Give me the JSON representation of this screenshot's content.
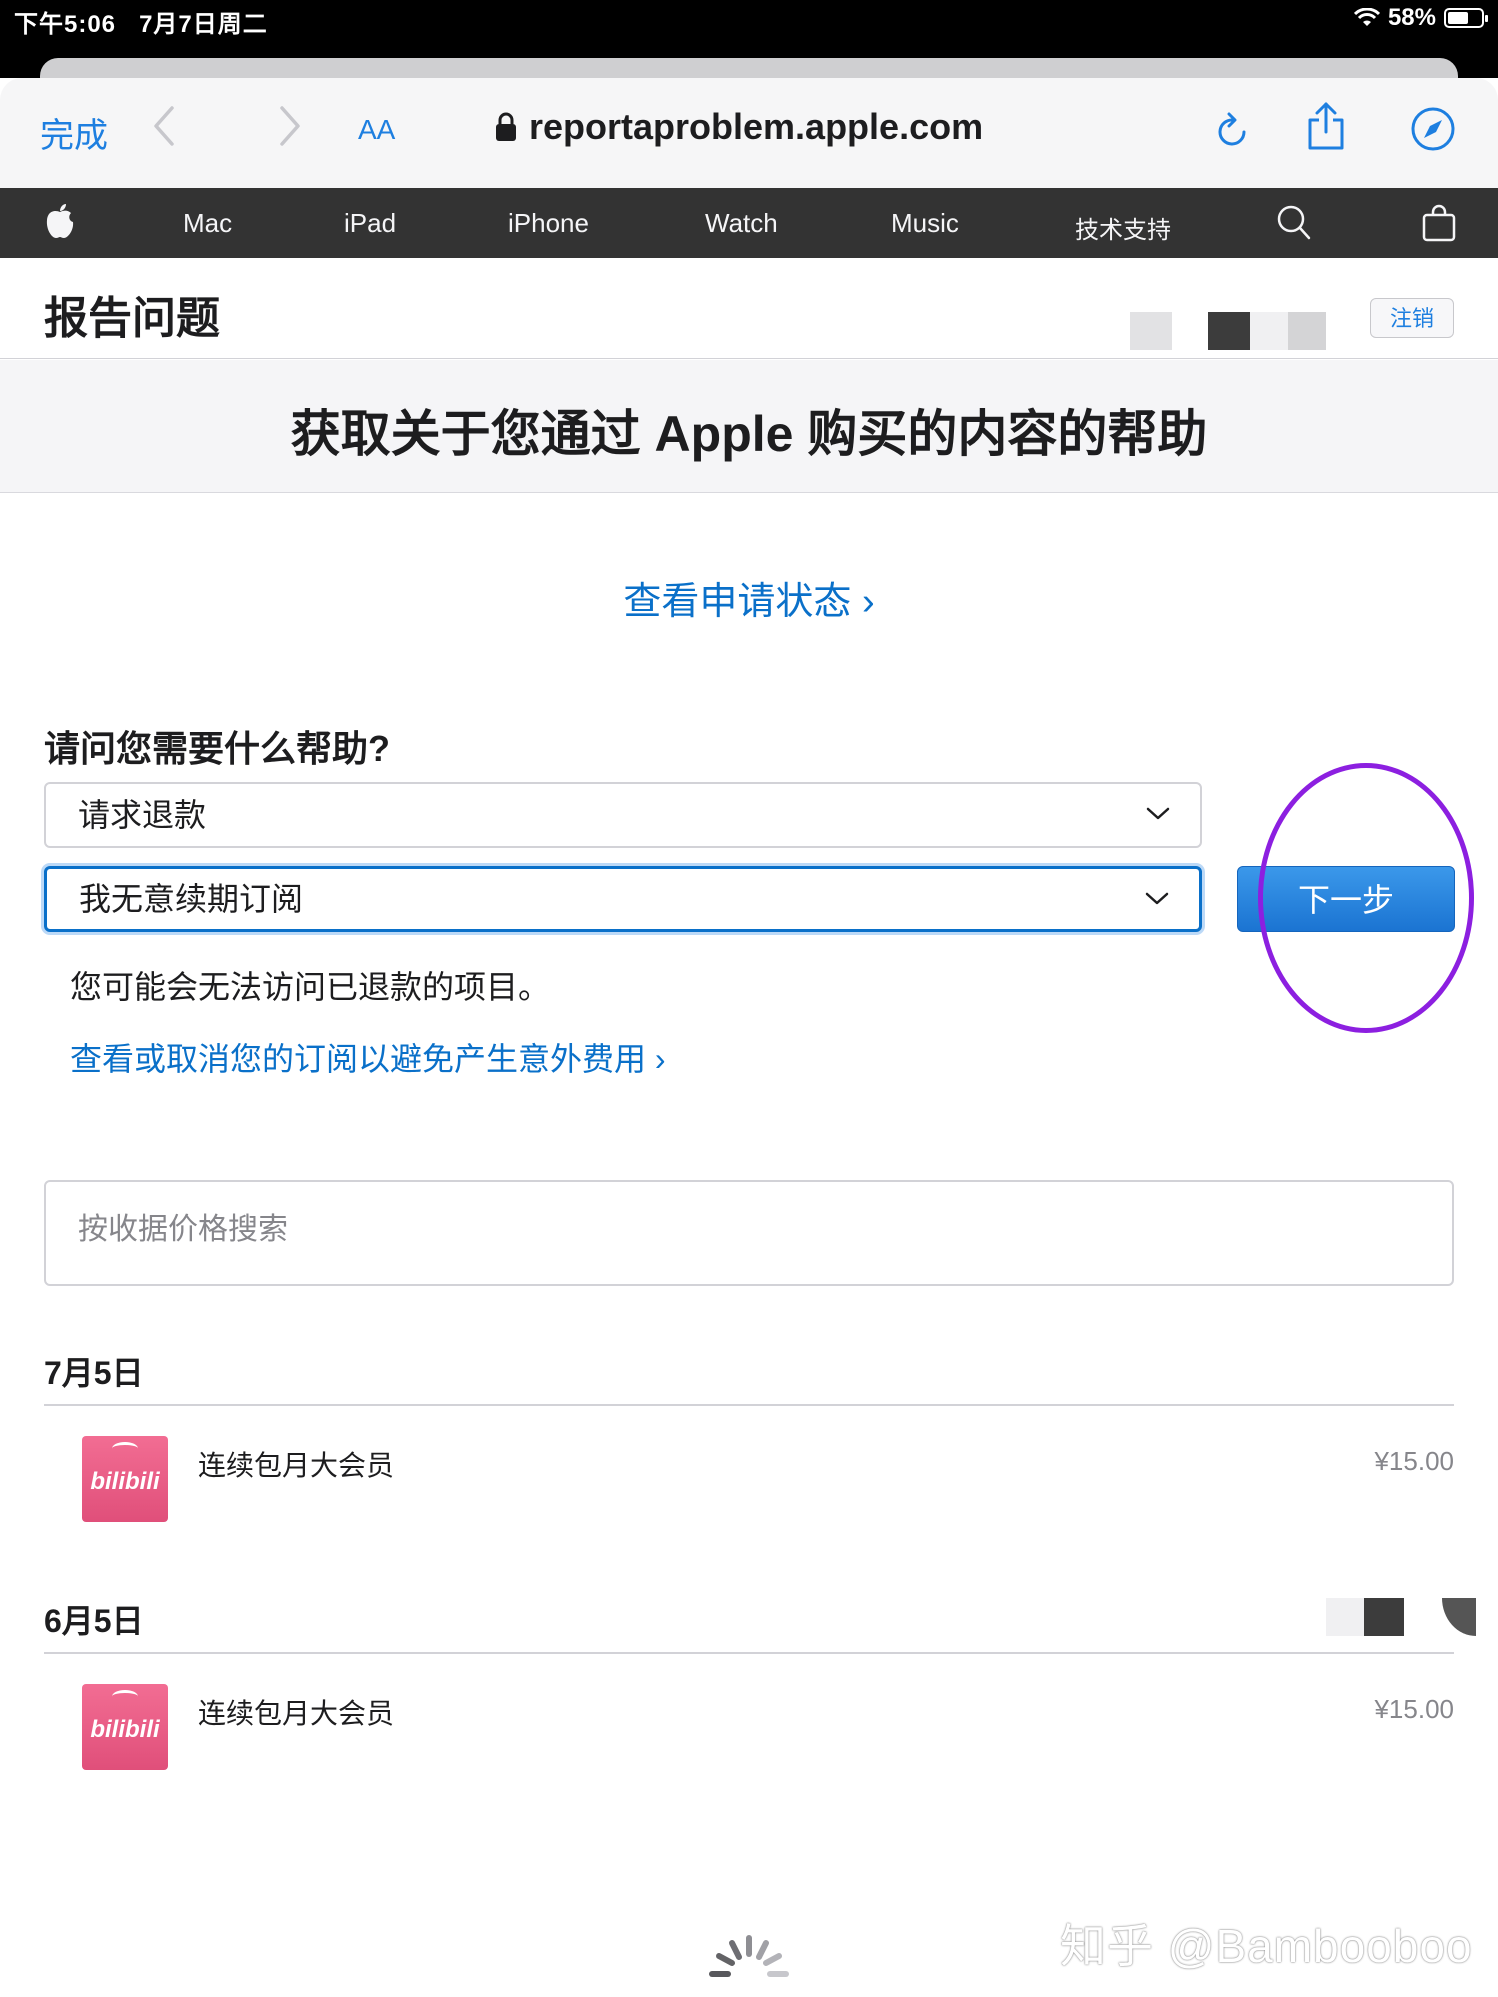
{
  "status_bar": {
    "time": "下午5:06",
    "date": "7月7日周二",
    "battery": "58%",
    "battery_level": 0.58
  },
  "browser": {
    "done_label": "完成",
    "text_size_label": "AA",
    "url": "reportaproblem.apple.com",
    "icons": [
      "chevron-left-icon",
      "chevron-right-icon",
      "lock-icon",
      "reload-icon",
      "share-icon",
      "compass-icon"
    ]
  },
  "global_nav": {
    "items": [
      "Mac",
      "iPad",
      "iPhone",
      "Watch",
      "Music",
      "技术支持"
    ],
    "icons": [
      "apple-logo-icon",
      "search-icon",
      "shopping-bag-icon"
    ]
  },
  "header": {
    "title": "报告问题",
    "logout_label": "注销"
  },
  "hero": {
    "title": "获取关于您通过 Apple 购买的内容的帮助"
  },
  "status_link": "查看申请状态 ›",
  "help": {
    "question": "请问您需要什么帮助?",
    "request_type": "请求退款",
    "reason": "我无意续期订阅",
    "next_label": "下一步",
    "note": "您可能会无法访问已退款的项目。",
    "manage_link": "查看或取消您的订阅以避免产生意外费用 ›"
  },
  "search": {
    "placeholder": "按收据价格搜索"
  },
  "purchases": [
    {
      "date": "7月5日",
      "app": "bilibili",
      "name": "连续包月大会员",
      "price": "¥15.00"
    },
    {
      "date": "6月5日",
      "app": "bilibili",
      "name": "连续包月大会员",
      "price": "¥15.00"
    }
  ],
  "watermark": "知乎 @Bambooboo",
  "colors": {
    "link": "#0a70c9",
    "nav_bg": "#333333",
    "button": "#1b74d2",
    "annotation": "#8c1fe0"
  }
}
